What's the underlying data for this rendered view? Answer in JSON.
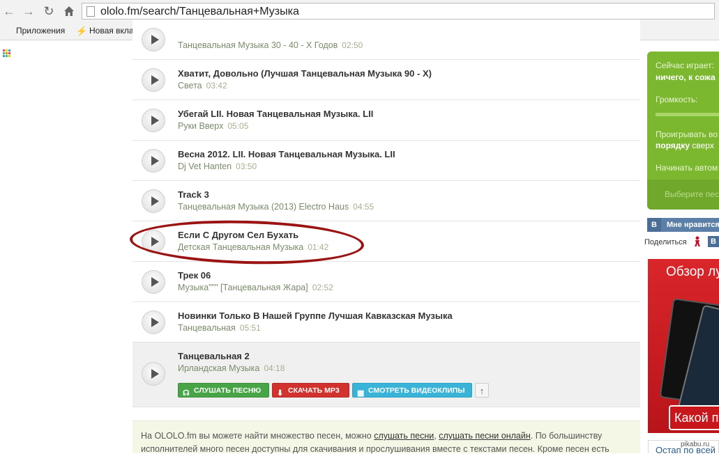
{
  "browser": {
    "url": "ololo.fm/search/Танцевальная+Музыка",
    "bookmarks": [
      "Приложения",
      "Новая вкладка"
    ]
  },
  "tracks": [
    {
      "title": "",
      "artist": "Танцевальная Музыка 30 - 40 - Х Годов",
      "duration": "02:50"
    },
    {
      "title": "Хватит, Довольно (Лучшая Танцевальная Музыка 90 - Х)",
      "artist": "Света",
      "duration": "03:42"
    },
    {
      "title": "Убегай LII. Новая Танцевальная Музыка. LII",
      "artist": "Руки Вверх",
      "duration": "05:05"
    },
    {
      "title": "Весна 2012. LII. Новая Танцевальная Музыка. LII",
      "artist": "Dj Vet Hanten",
      "duration": "03:50"
    },
    {
      "title": "Track 3",
      "artist": "Танцевальная Музыка (2013) Electro Haus",
      "duration": "04:55"
    },
    {
      "title": "Если С Другом Сел Бухать",
      "artist": "Детская Танцевальная Музыка",
      "duration": "01:42"
    },
    {
      "title": "Трек 06",
      "artist": "Музыка\"\"\" [Танцевальная Жара]",
      "duration": "02:52"
    },
    {
      "title": "Новинки Только В Нашей Группе Лучшая Кавказская Музыка",
      "artist": "Танцевальная",
      "duration": "05:51"
    },
    {
      "title": "Танцевальная 2",
      "artist": "Ирландская Музыка",
      "duration": "04:18"
    }
  ],
  "actions": {
    "listen": "СЛУШАТЬ ПЕСНЮ",
    "download": "СКАЧАТЬ MP3",
    "videos": "СМОТРЕТЬ ВИДЕОКЛИПЫ",
    "up": "↑"
  },
  "info": {
    "text1": "На OLOLO.fm вы можете найти множество песен, можно ",
    "link1": "слушать песни",
    "sep": ", ",
    "link2": "слушать песни онлайн",
    "text2": ". По большинству исполнителей много песен доступны для скачивания и прослушивания вместе с текстами песен. Кроме песен есть"
  },
  "player": {
    "now_playing_label": "Сейчас играет:",
    "now_playing_value": "ничего, к сожа",
    "volume_label": "Громкость:",
    "play_order_1": "Проигрывать во",
    "play_order_2_bold": "порядку",
    "play_order_2_rest": " сверх",
    "autostart": "Начинать автом",
    "choose": "Выберите песн",
    "volume_level": 0.9
  },
  "social": {
    "vk_logo": "B",
    "like": "Мне нравится",
    "share": "Поделиться",
    "vk_small": "B"
  },
  "ad": {
    "heading": "Обзор лу",
    "cta": "Какой п"
  },
  "sidebox": {
    "text": "Остап по всей"
  },
  "watermark": "pikabu.ru"
}
